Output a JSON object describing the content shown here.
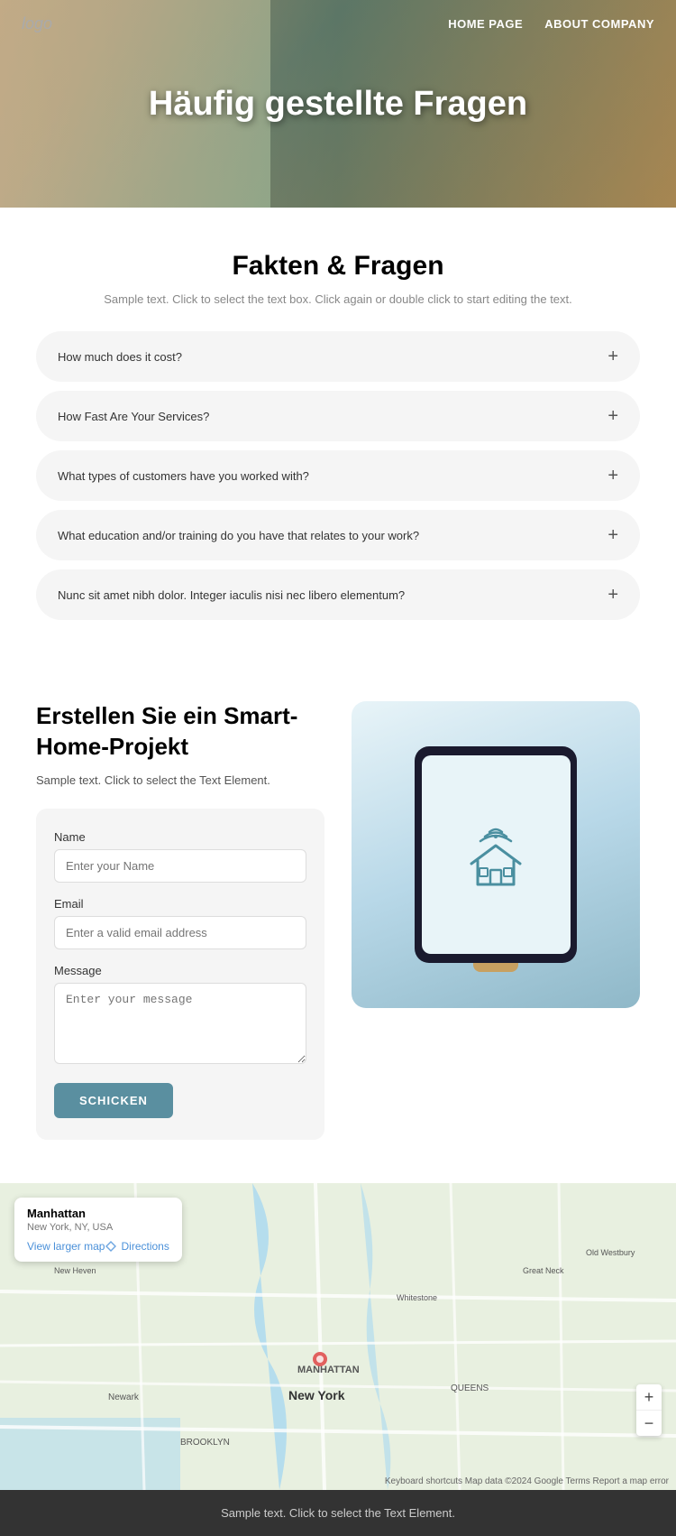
{
  "nav": {
    "logo": "logo",
    "links": [
      {
        "label": "HOME PAGE",
        "id": "home-link"
      },
      {
        "label": "ABOUT COMPANY",
        "id": "about-link"
      }
    ]
  },
  "hero": {
    "title": "Häufig gestellte Fragen"
  },
  "faq": {
    "heading": "Fakten & Fragen",
    "subtext": "Sample text. Click to select the text box. Click again or double click to start editing the text.",
    "items": [
      {
        "id": "faq-1",
        "question": "How much does it cost?"
      },
      {
        "id": "faq-2",
        "question": "How Fast Are Your Services?"
      },
      {
        "id": "faq-3",
        "question": "What types of customers have you worked with?"
      },
      {
        "id": "faq-4",
        "question": "What education and/or training do you have that relates to your work?"
      },
      {
        "id": "faq-5",
        "question": "Nunc sit amet nibh dolor. Integer iaculis nisi nec libero elementum?"
      }
    ],
    "icon": "+"
  },
  "smart": {
    "title": "Erstellen Sie ein Smart-Home-Projekt",
    "subtext": "Sample text. Click to select the Text Element.",
    "form": {
      "name_label": "Name",
      "name_placeholder": "Enter your Name",
      "email_label": "Email",
      "email_placeholder": "Enter a valid email address",
      "message_label": "Message",
      "message_placeholder": "Enter your message",
      "submit_label": "SCHICKEN"
    }
  },
  "map": {
    "popup_title": "Manhattan",
    "popup_subtitle": "New York, NY, USA",
    "view_larger": "View larger map",
    "directions": "Directions",
    "attribution": "Keyboard shortcuts  Map data ©2024 Google  Terms  Report a map error",
    "zoom_in": "+",
    "zoom_out": "−"
  },
  "footer": {
    "text": "Sample text. Click to select the Text Element."
  }
}
